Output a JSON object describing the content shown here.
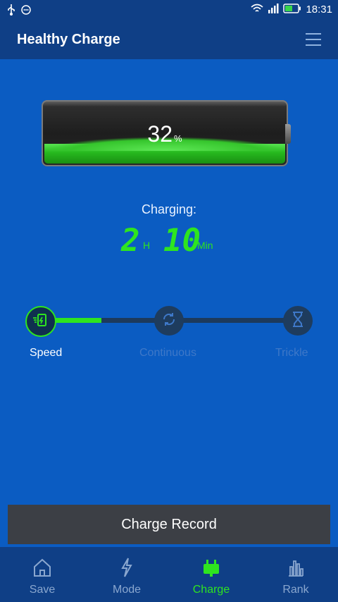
{
  "status": {
    "time": "18:31",
    "icons": [
      "usb-icon",
      "notification-icon",
      "wifi-icon",
      "signal-icon",
      "battery-icon"
    ]
  },
  "header": {
    "title": "Healthy Charge",
    "menu_icon": "menu-icon"
  },
  "battery": {
    "percent": "32",
    "percent_unit": "%",
    "level": 0.32
  },
  "charging": {
    "label": "Charging:",
    "hours": "2",
    "hours_unit": "H",
    "minutes": "10",
    "minutes_unit": "Min"
  },
  "modes": [
    {
      "label": "Speed",
      "icon": "speed-charge-icon",
      "active": true
    },
    {
      "label": "Continuous",
      "icon": "continuous-cycle-icon",
      "active": false
    },
    {
      "label": "Trickle",
      "icon": "hourglass-icon",
      "active": false
    }
  ],
  "record_button": "Charge Record",
  "nav": [
    {
      "label": "Save",
      "icon": "home-icon",
      "active": false
    },
    {
      "label": "Mode",
      "icon": "lightning-icon",
      "active": false
    },
    {
      "label": "Charge",
      "icon": "charge-plug-icon",
      "active": true
    },
    {
      "label": "Rank",
      "icon": "bar-chart-icon",
      "active": false
    }
  ],
  "colors": {
    "accent": "#2ee51f",
    "background": "#0b5cc2",
    "bar": "#0f3f86",
    "button": "#3c3f45"
  }
}
